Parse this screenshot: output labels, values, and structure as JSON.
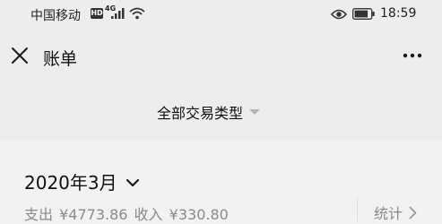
{
  "status_bar": {
    "carrier": "中国移动",
    "hd_badge": "HD",
    "network": "4G",
    "time": "18:59",
    "icons": [
      "signal-icon",
      "wifi-icon",
      "eye-icon",
      "battery-icon"
    ]
  },
  "nav": {
    "title": "账单",
    "close_icon": "close-icon",
    "more_icon": "more-icon"
  },
  "filter": {
    "label": "全部交易类型",
    "caret_icon": "caret-down-icon"
  },
  "summary": {
    "month": "2020年3月",
    "expense_label": "支出",
    "expense_value": "¥4773.86",
    "income_label": "收入",
    "income_value": "¥330.80",
    "stats_label": "统计"
  },
  "colors": {
    "header_bg": "#ededed",
    "body_bg": "#f2f2f2",
    "muted_text": "#8a8a8a"
  }
}
